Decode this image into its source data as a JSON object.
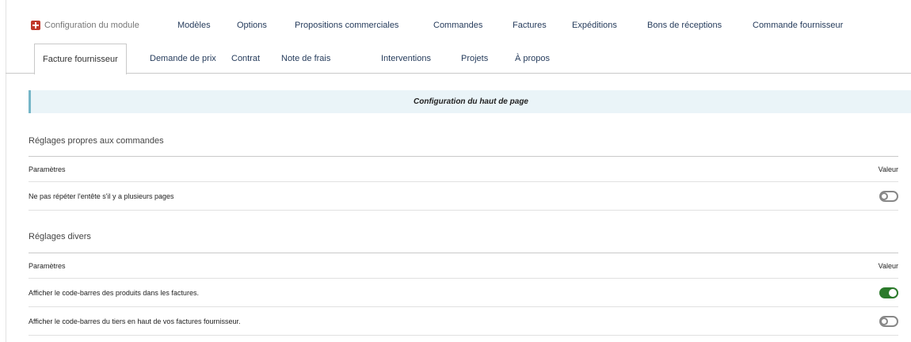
{
  "nav_row1": {
    "module_tab": "Configuration du module",
    "tabs": [
      "Modèles",
      "Options",
      "Propositions commerciales",
      "Commandes",
      "Factures",
      "Expéditions",
      "Bons de réceptions",
      "Commande fournisseur"
    ]
  },
  "nav_row2": {
    "tabs": [
      "Facture fournisseur",
      "Demande de prix",
      "Contrat",
      "Note de frais",
      "Interventions",
      "Projets",
      "À propos"
    ],
    "active_index": 0
  },
  "banner": {
    "title": "Configuration du haut de page"
  },
  "section_orders": {
    "title": "Réglages propres aux commandes",
    "col_param": "Paramètres",
    "col_value": "Valeur",
    "rows": [
      {
        "label": "Ne pas répéter l'entête s'il y a plusieurs pages",
        "enabled": false
      }
    ]
  },
  "section_misc": {
    "title": "Réglages divers",
    "col_param": "Paramètres",
    "col_value": "Valeur",
    "rows": [
      {
        "label": "Afficher le code-barres des produits dans les factures.",
        "enabled": true
      },
      {
        "label": "Afficher le code-barres du tiers en haut de vos factures fournisseur.",
        "enabled": false
      }
    ]
  },
  "colors": {
    "link": "#263c5c",
    "toggle_on": "#2b7a2b",
    "toggle_off": "#888888",
    "banner_bg": "#eaf4f8",
    "banner_accent": "#76b6c8",
    "module_icon": "#c0392b"
  },
  "icons": {
    "module": "module-config-icon",
    "toggle_on": "toggle-on-icon",
    "toggle_off": "toggle-off-icon"
  }
}
